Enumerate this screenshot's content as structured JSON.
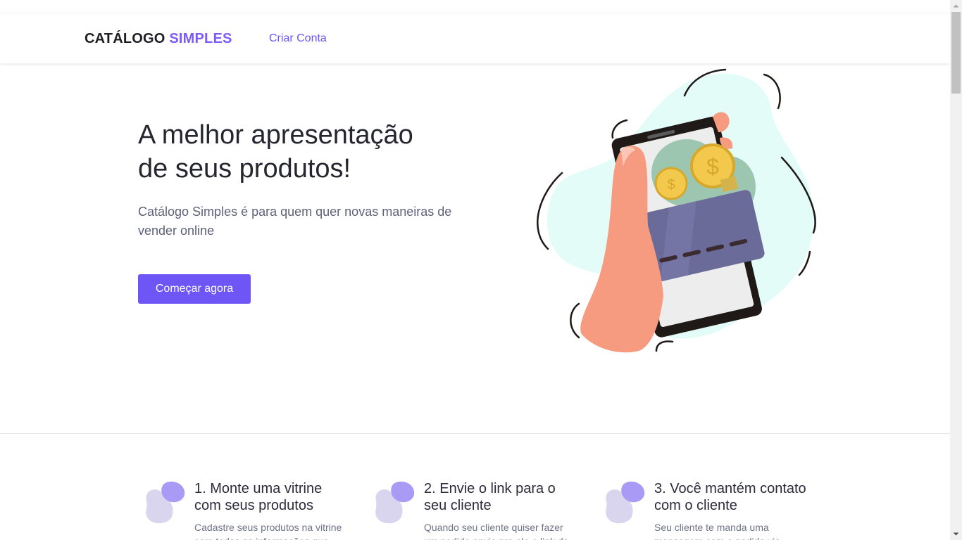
{
  "header": {
    "logo_main": "CATÁLOGO",
    "logo_accent": "SIMPLES",
    "nav_create_account": "Criar Conta"
  },
  "hero": {
    "title_line1": "A melhor apresentação",
    "title_line2": "de seus produtos!",
    "subtitle": "Catálogo Simples é para quem quer novas maneiras de vender online",
    "cta_label": "Começar agora"
  },
  "steps": [
    {
      "title": "1. Monte uma vitrine com seus produtos",
      "description": "Cadastre seus produtos na vitrine com todas as informações que seus"
    },
    {
      "title": "2. Envie o link para o seu cliente",
      "description": "Quando seu cliente quiser fazer um pedido envie pra ele o link da vitrine"
    },
    {
      "title": "3. Você mantém contato com o cliente",
      "description": "Seu cliente te manda uma mensagem com o pedido via WhatsApp, assim"
    }
  ],
  "colors": {
    "accent": "#6d55f6",
    "blob_light": "#d9d5ee",
    "blob_dark": "#a99bf5",
    "mint": "#e3fcf7"
  }
}
